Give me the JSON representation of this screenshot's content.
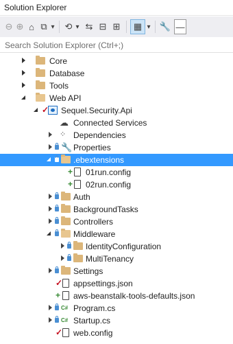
{
  "window": {
    "title": "Solution Explorer"
  },
  "toolbar": {
    "buttons": [
      {
        "name": "back-icon",
        "glyph": "⊖"
      },
      {
        "name": "forward-icon",
        "glyph": "⊕"
      },
      {
        "name": "home-icon",
        "glyph": "⌂"
      },
      {
        "name": "switch-views-icon",
        "glyph": "⧉"
      },
      {
        "name": "dropdown-icon",
        "glyph": "▾"
      },
      {
        "name": "pending-changes-icon",
        "glyph": "⟲"
      },
      {
        "name": "sync-icon",
        "glyph": "⇆"
      },
      {
        "name": "collapse-all-icon",
        "glyph": "⊟"
      },
      {
        "name": "show-all-files-icon",
        "glyph": "⊞"
      },
      {
        "name": "preview-selected-icon",
        "glyph": "▦"
      },
      {
        "name": "properties-icon",
        "glyph": "🔧"
      },
      {
        "name": "pin-icon",
        "glyph": "—"
      }
    ]
  },
  "search": {
    "placeholder": "Search Solution Explorer (Ctrl+;)"
  },
  "tree": {
    "items": [
      {
        "label": "Core"
      },
      {
        "label": "Database"
      },
      {
        "label": "Tools"
      },
      {
        "label": "Web API"
      },
      {
        "label": "Sequel.Security.Api"
      },
      {
        "label": "Connected Services"
      },
      {
        "label": "Dependencies"
      },
      {
        "label": "Properties"
      },
      {
        "label": ".ebextensions"
      },
      {
        "label": "01run.config"
      },
      {
        "label": "02run.config"
      },
      {
        "label": "Auth"
      },
      {
        "label": "BackgroundTasks"
      },
      {
        "label": "Controllers"
      },
      {
        "label": "Middleware"
      },
      {
        "label": "IdentityConfiguration"
      },
      {
        "label": "MultiTenancy"
      },
      {
        "label": "Settings"
      },
      {
        "label": "appsettings.json"
      },
      {
        "label": "aws-beanstalk-tools-defaults.json"
      },
      {
        "label": "Program.cs"
      },
      {
        "label": "Startup.cs"
      },
      {
        "label": "web.config"
      }
    ]
  },
  "colors": {
    "selection": "#3399ff",
    "folder": "#dcb67a",
    "added": "#388a34",
    "modified": "#c50f1f",
    "lock": "#4a8fd3"
  }
}
